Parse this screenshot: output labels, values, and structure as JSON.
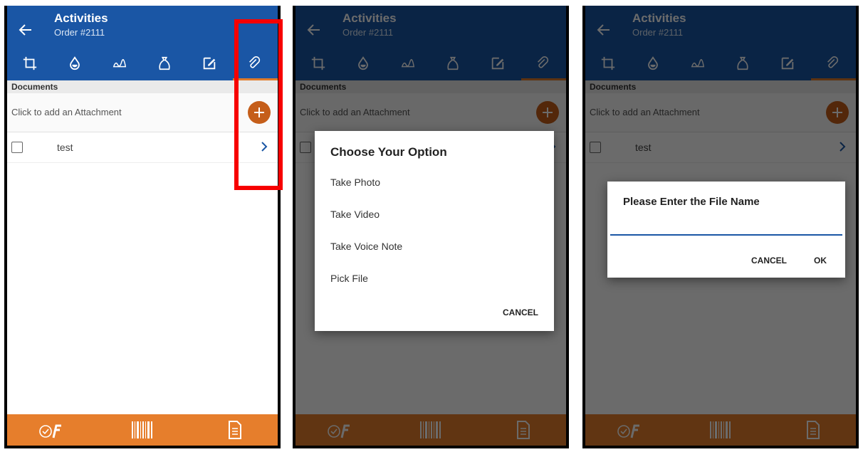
{
  "app": {
    "title": "Activities",
    "order_number": "Order #2111",
    "tab_icons": [
      "crop-icon",
      "drop-icon",
      "sketch-icon",
      "bag-icon",
      "edit-icon",
      "paperclip-icon"
    ],
    "section_label": "Documents",
    "add_attachment_text": "Click to add an Attachment",
    "document_item": "test",
    "bottom_icons": [
      "wrench-check-icon",
      "barcode-icon",
      "document-icon"
    ],
    "colors": {
      "app_bar": "#1a56a5",
      "bottom_bar": "#e67e2c",
      "fab": "#c55e1a",
      "highlight": "#f70000"
    }
  },
  "option_dialog": {
    "title": "Choose Your Option",
    "options": [
      "Take Photo",
      "Take Video",
      "Take Voice Note",
      "Pick File"
    ],
    "cancel_label": "CANCEL"
  },
  "filename_dialog": {
    "title": "Please Enter the File Name",
    "input_value": "",
    "cancel_label": "CANCEL",
    "ok_label": "OK"
  }
}
